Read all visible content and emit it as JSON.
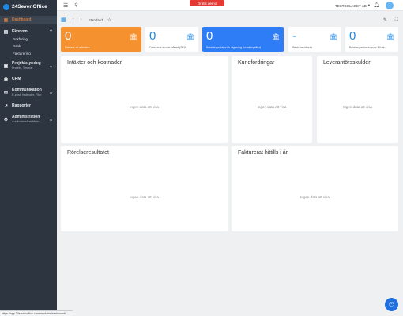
{
  "app": {
    "brand": "24SevenOffice"
  },
  "header": {
    "demo_label": "Gratis demo",
    "company": "TESTBOLAGET AB",
    "avatar_initial": "J"
  },
  "toolbar": {
    "view_name": "Standard"
  },
  "sidebar": {
    "dashboard": "Dashboard",
    "economy": "Ekonomi",
    "economy_items": [
      "Bokföring",
      "Bank",
      "Fakturering"
    ],
    "projects": {
      "label": "Projektstyrning",
      "sub": "Projekt, Timmar"
    },
    "crm": "CRM",
    "communication": {
      "label": "Kommunikation",
      "sub": "E-post, Kalender, Filer"
    },
    "reports": "Rapporter",
    "admin": {
      "label": "Administration",
      "sub": "Användare/Inställnin..."
    }
  },
  "kpis": [
    {
      "value": "0",
      "label": "Fakturor att attestera"
    },
    {
      "value": "0",
      "label": "Fakturerat denna månad (SEK)"
    },
    {
      "value": "0",
      "label": "Betalningar klara för signering (betalningsfiler)"
    },
    {
      "value": "-",
      "label": "Saldo bankkonto"
    },
    {
      "value": "0",
      "label": "Betalningar kommande 14 da..."
    }
  ],
  "widgets": {
    "income": {
      "title": "Intäkter och kostnader",
      "empty": "Ingen data att visa"
    },
    "receivables": {
      "title": "Kundfordringar",
      "empty": "Ingen data att visa"
    },
    "payables": {
      "title": "Leverantörsskulder",
      "empty": "Ingen data att visa"
    },
    "operating": {
      "title": "Rörelseresultatet",
      "empty": "Ingen data att visa"
    },
    "invoiced": {
      "title": "Fakturerat hittills i år",
      "empty": "Ingen data att visa"
    }
  },
  "status_url": "https://app.24sevenoffice.com/modules/dashboard/"
}
